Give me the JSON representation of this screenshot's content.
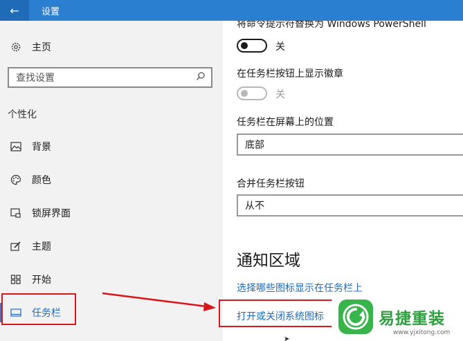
{
  "titlebar": {
    "title": "设置",
    "back_icon": "back-arrow-icon"
  },
  "sidebar": {
    "home_label": "主页",
    "search_placeholder": "查找设置",
    "group_label": "个性化",
    "items": [
      {
        "label": "背景",
        "icon": "picture-icon"
      },
      {
        "label": "颜色",
        "icon": "palette-icon"
      },
      {
        "label": "锁屏界面",
        "icon": "lockscreen-icon"
      },
      {
        "label": "主题",
        "icon": "theme-brush-icon"
      },
      {
        "label": "开始",
        "icon": "start-grid-icon"
      },
      {
        "label": "任务栏",
        "icon": "taskbar-icon",
        "active": true
      }
    ]
  },
  "main": {
    "cut_label": "将命令提示符替换为 Windows PowerShell",
    "toggle1_state": "关",
    "badge_label": "在任务栏按钮上显示徽章",
    "toggle2_state": "关",
    "position_label": "任务栏在屏幕上的位置",
    "position_value": "底部",
    "combine_label": "合并任务栏按钮",
    "combine_value": "从不",
    "section_title": "通知区域",
    "link1": "选择哪些图标显示在任务栏上",
    "link2": "打开或关闭系统图标"
  },
  "watermark": {
    "brand": "易捷重装",
    "url": "www.yjxitong.com"
  },
  "colors": {
    "accent": "#2b7fd0",
    "annotation_red": "#d8161b",
    "brand_green": "#37b44a"
  }
}
